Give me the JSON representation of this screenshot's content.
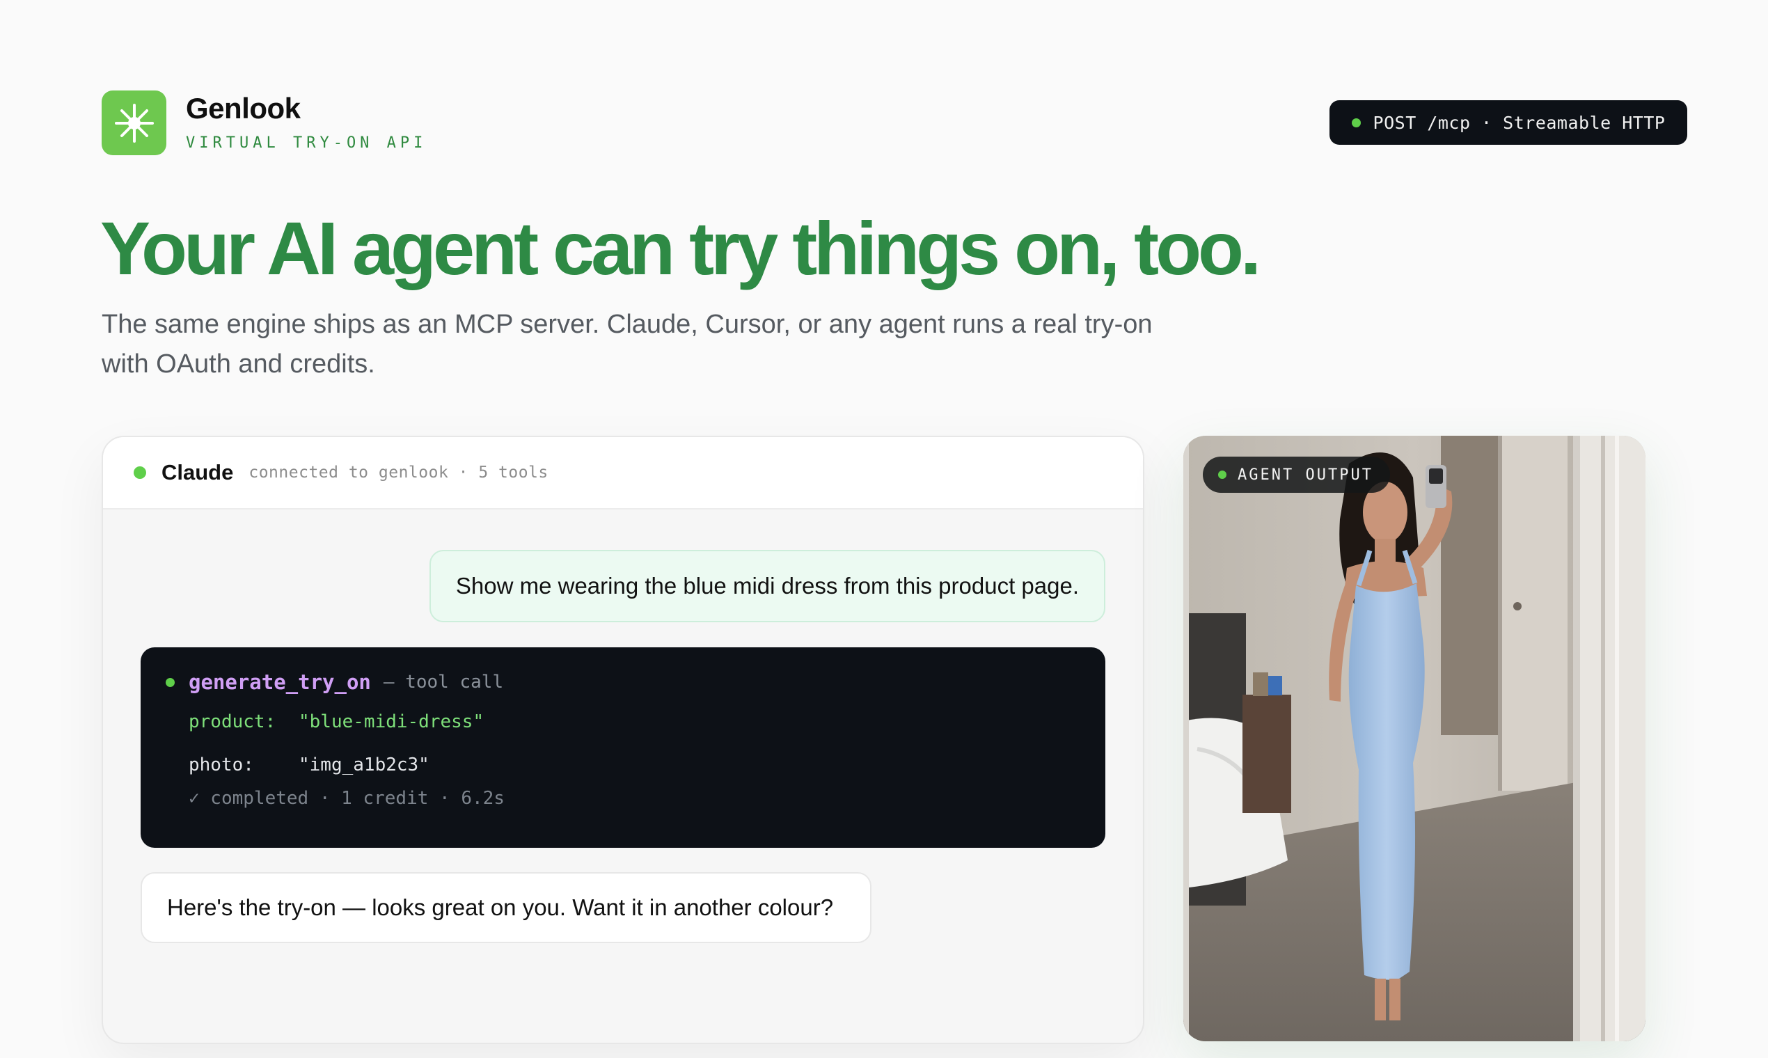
{
  "brand": {
    "name": "Genlook",
    "tagline": "VIRTUAL TRY-ON API",
    "logo_icon": "starburst-icon",
    "accent": "#6ec84f"
  },
  "endpoint": {
    "label": "POST /mcp · Streamable HTTP",
    "status_color": "#5fcf4a"
  },
  "hero": {
    "headline": "Your AI agent can try things on, too.",
    "subhead": "The same engine ships as an MCP server. Claude, Cursor, or any agent runs a real try-on with OAuth and credits.",
    "headline_color": "#2e8a45"
  },
  "chat": {
    "agent_name": "Claude",
    "status": "connected to genlook · 5 tools",
    "user_message": "Show me wearing the blue midi dress from this product page.",
    "tool_call": {
      "name": "generate_try_on",
      "kind": "— tool call",
      "args": [
        {
          "key": "product:",
          "value": "\"blue-midi-dress\""
        },
        {
          "key": "photo:",
          "value": "\"img_a1b2c3\""
        }
      ],
      "result": "✓ completed · 1 credit · 6.2s"
    },
    "assistant_message": "Here's the try-on — looks great on you. Want it in another colour?"
  },
  "output": {
    "badge": "AGENT OUTPUT",
    "image_subject": "woman in blue midi dress mirror selfie"
  }
}
